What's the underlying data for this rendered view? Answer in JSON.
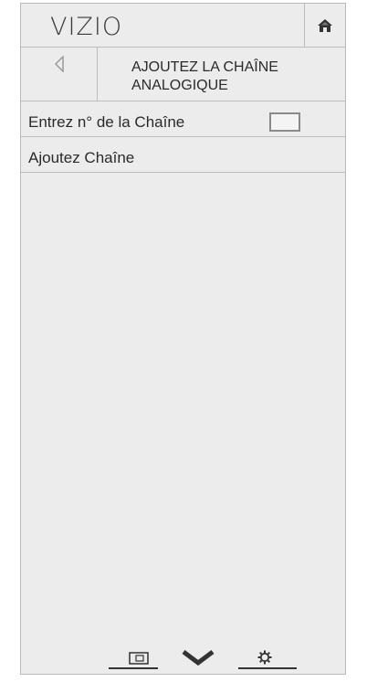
{
  "header": {
    "logo": "VIZIO",
    "home_icon": "home-icon"
  },
  "subheader": {
    "back_icon": "back-arrow-icon",
    "title_line1": "AJOUTEZ LA CHAÎNE",
    "title_line2": "ANALOGIQUE"
  },
  "menu": {
    "items": [
      {
        "label": "Entrez n° de la Chaîne",
        "input_value": ""
      },
      {
        "label": "Ajoutez Chaîne"
      }
    ]
  },
  "footer": {
    "icons": [
      "input-icon",
      "vizio-v-icon",
      "settings-gear-icon"
    ]
  }
}
